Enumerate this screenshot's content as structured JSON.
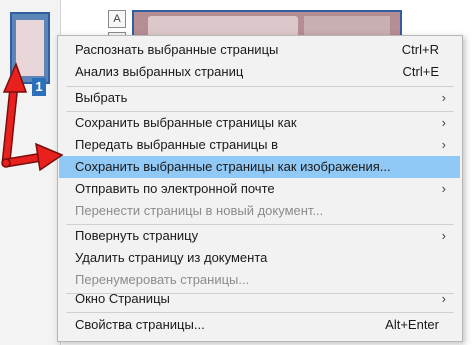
{
  "thumbnail": {
    "page_number": "1"
  },
  "toolbar": {
    "text_icon_glyph": "A"
  },
  "menu": {
    "recognize_label": "Распознать выбранные страницы",
    "recognize_shortcut": "Ctrl+R",
    "analyze_label": "Анализ выбранных страниц",
    "analyze_shortcut": "Ctrl+E",
    "select_label": "Выбрать",
    "save_as_label": "Сохранить выбранные страницы как",
    "send_to_label": "Передать выбранные страницы в",
    "save_as_images_label": "Сохранить выбранные страницы как изображения...",
    "email_label": "Отправить по электронной почте",
    "move_to_new_doc_label": "Перенести страницы в новый документ...",
    "rotate_label": "Повернуть страницу",
    "delete_label": "Удалить страницу из документа",
    "renumber_label": "Перенумеровать страницы...",
    "pages_window_label": "Окно Страницы",
    "properties_label": "Свойства страницы...",
    "properties_shortcut": "Alt+Enter",
    "submenu_arrow": "›"
  },
  "colors": {
    "highlight": "#90c8f6",
    "annotation_arrow": "#e8211e"
  }
}
